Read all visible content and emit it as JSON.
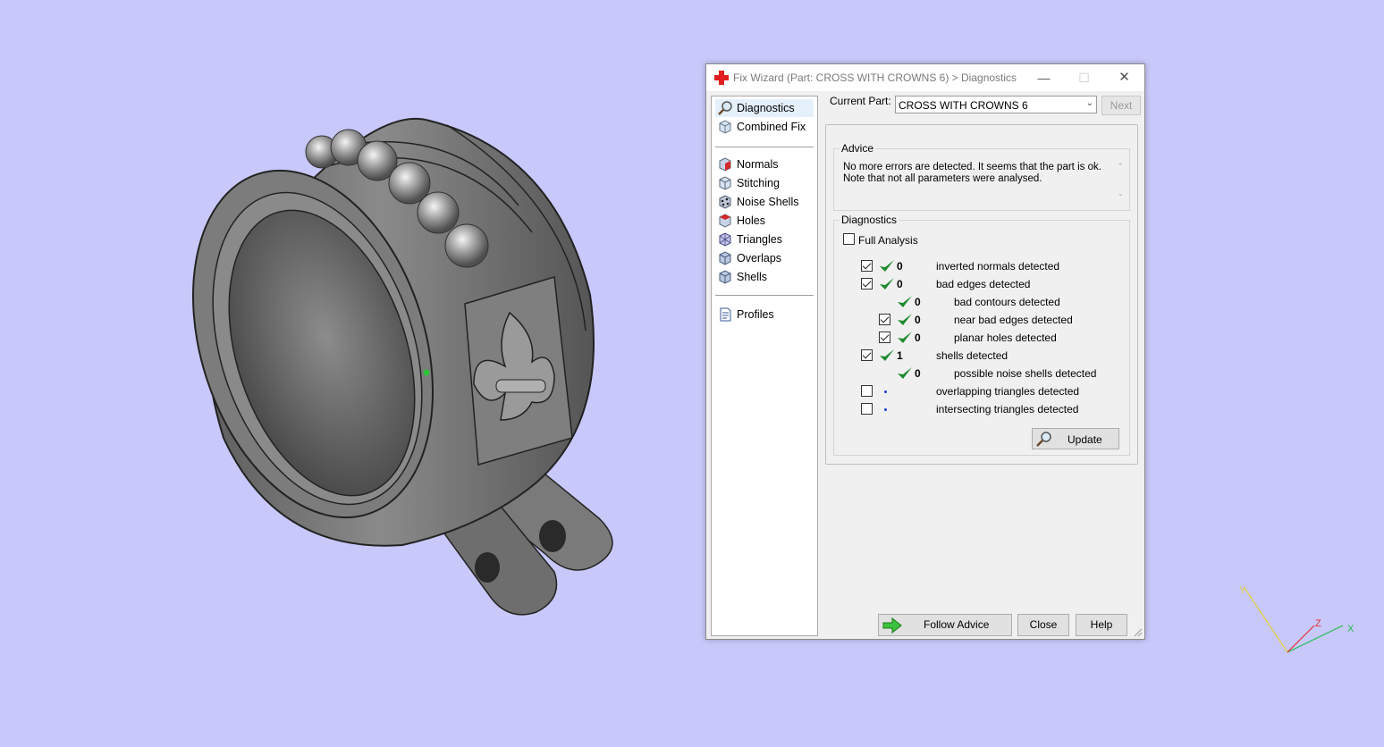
{
  "dialog": {
    "title": "Fix Wizard (Part: CROSS WITH CROWNS 6) > Diagnostics",
    "minimize_icon": "minimize-icon",
    "maximize_icon": "maximize-icon",
    "close_icon": "close-icon"
  },
  "nav": {
    "top_items": [
      {
        "label": "Diagnostics",
        "icon": "magnifier-icon",
        "selected": true
      },
      {
        "label": "Combined Fix",
        "icon": "cube-icon"
      }
    ],
    "fix_items": [
      {
        "label": "Normals",
        "icon": "normals-icon"
      },
      {
        "label": "Stitching",
        "icon": "stitching-icon"
      },
      {
        "label": "Noise Shells",
        "icon": "noise-shells-icon"
      },
      {
        "label": "Holes",
        "icon": "holes-icon"
      },
      {
        "label": "Triangles",
        "icon": "triangles-icon"
      },
      {
        "label": "Overlaps",
        "icon": "overlaps-icon"
      },
      {
        "label": "Shells",
        "icon": "shells-icon"
      }
    ],
    "bottom_items": [
      {
        "label": "Profiles",
        "icon": "document-icon"
      }
    ]
  },
  "current_part": {
    "label": "Current Part:",
    "value": "CROSS WITH CROWNS 6",
    "next_label": "Next"
  },
  "advice": {
    "title": "Advice",
    "text": "No more errors are detected. It seems that the part is ok. Note that not all parameters were analysed."
  },
  "diagnostics": {
    "title": "Diagnostics",
    "full_analysis_label": "Full Analysis",
    "full_analysis_checked": false,
    "rows": [
      {
        "checkbox": true,
        "checked": true,
        "status": "ok",
        "count": "0",
        "label": "inverted normals detected",
        "indent": 0
      },
      {
        "checkbox": true,
        "checked": true,
        "status": "ok",
        "count": "0",
        "label": "bad edges detected",
        "indent": 0
      },
      {
        "checkbox": false,
        "checked": false,
        "status": "ok",
        "count": "0",
        "label": "bad contours detected",
        "indent": 1
      },
      {
        "checkbox": true,
        "checked": true,
        "status": "ok",
        "count": "0",
        "label": "near bad edges detected",
        "indent": 1
      },
      {
        "checkbox": true,
        "checked": true,
        "status": "ok",
        "count": "0",
        "label": "planar holes detected",
        "indent": 1
      },
      {
        "checkbox": true,
        "checked": true,
        "status": "ok",
        "count": "1",
        "label": "shells detected",
        "indent": 0
      },
      {
        "checkbox": false,
        "checked": false,
        "status": "ok",
        "count": "0",
        "label": "possible noise shells detected",
        "indent": 1
      },
      {
        "checkbox": true,
        "checked": false,
        "status": "none",
        "count": "",
        "label": "overlapping triangles detected",
        "indent": 0
      },
      {
        "checkbox": true,
        "checked": false,
        "status": "none",
        "count": "",
        "label": "intersecting triangles detected",
        "indent": 0
      }
    ],
    "update_label": "Update"
  },
  "buttons": {
    "follow_advice": "Follow Advice",
    "close": "Close",
    "help": "Help"
  },
  "axes": {
    "x": "X",
    "y": "Y",
    "z": "Z"
  },
  "colors": {
    "background": "#c8c8fa",
    "check_green": "#1e8a2e",
    "axis_x": "#1fbf4f",
    "axis_y": "#e0d040",
    "axis_z": "#e03030"
  }
}
